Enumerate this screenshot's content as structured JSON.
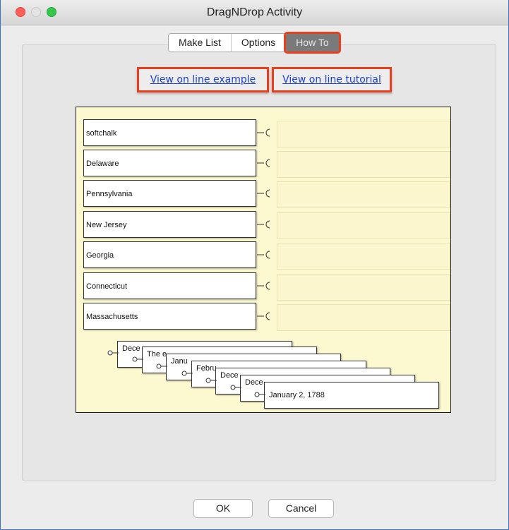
{
  "window": {
    "title": "DragNDrop Activity"
  },
  "tabs": [
    {
      "label": "Make List"
    },
    {
      "label": "Options"
    },
    {
      "label": "How To",
      "active": true
    }
  ],
  "links": {
    "example": "View on line example",
    "tutorial": "View on line tutorial"
  },
  "preview": {
    "sources": [
      "softchalk",
      "Delaware",
      "Pennsylvania",
      "New Jersey",
      "Georgia",
      "Connecticut",
      "Massachusetts"
    ],
    "cards": [
      "Dece",
      "The e",
      "Janu",
      "Febru",
      "Dece",
      "Dece",
      "January 2, 1788"
    ]
  },
  "buttons": {
    "ok": "OK",
    "cancel": "Cancel"
  },
  "colors": {
    "highlight": "#e8401f",
    "link": "#1a3fd3",
    "preview_bg": "#fcf8d0"
  }
}
